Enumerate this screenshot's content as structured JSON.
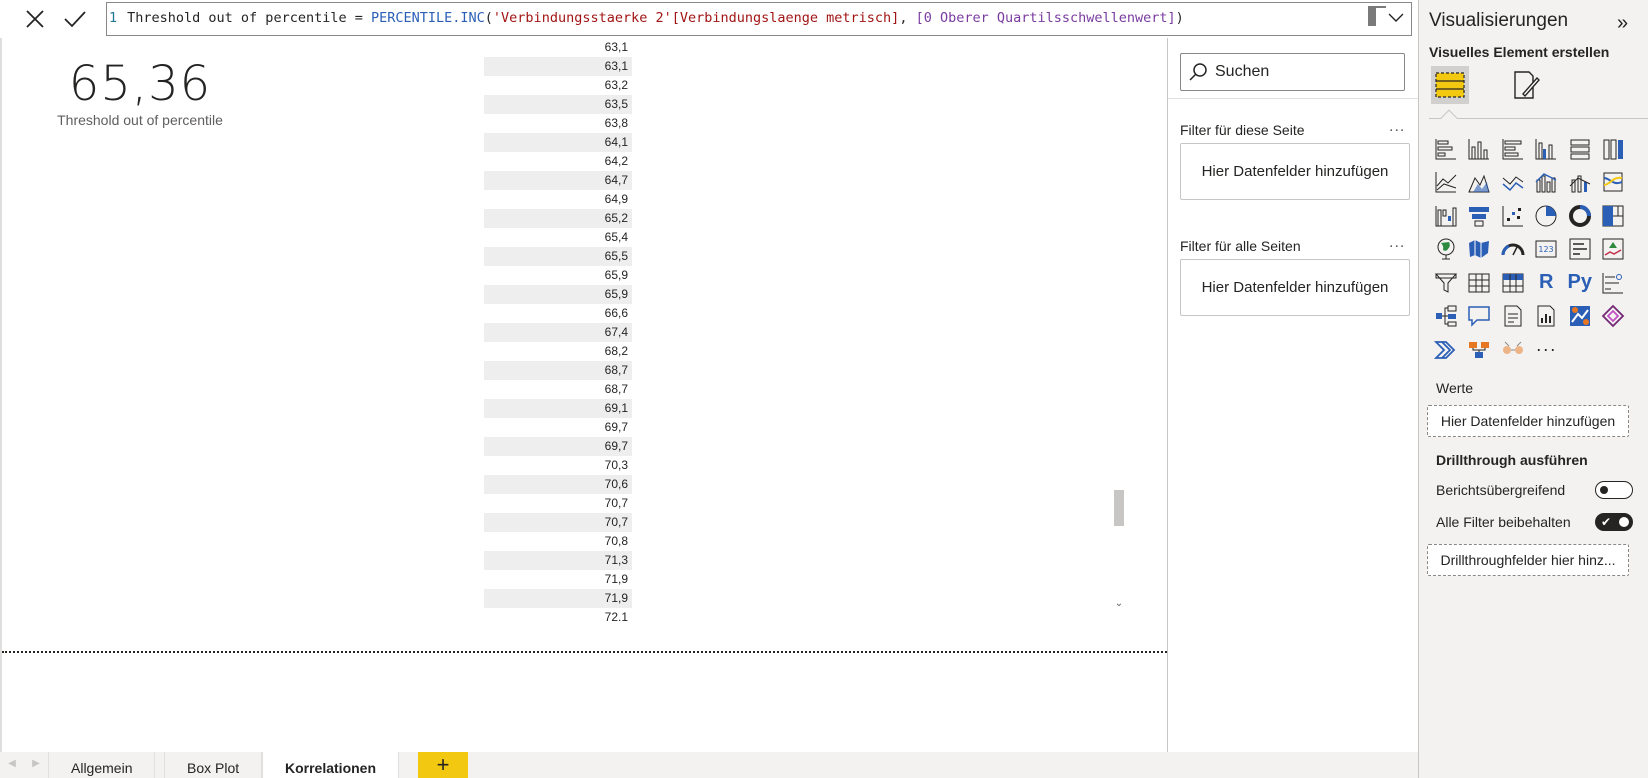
{
  "formula": {
    "line_number": "1",
    "measure_name": "Threshold out of percentile = ",
    "function": "PERCENTILE.INC",
    "open_paren": "(",
    "table_column": "'Verbindungsstaerke 2'[Verbindungslaenge metrisch]",
    "separator": ", ",
    "measure_ref": "[0 Oberer Quartilsschwellenwert]",
    "close_paren": ")"
  },
  "card": {
    "value": "65,36",
    "label": "Threshold out of percentile"
  },
  "value_list": [
    "63,1",
    "63,1",
    "63,2",
    "63,5",
    "63,8",
    "64,1",
    "64,2",
    "64,7",
    "64,9",
    "65,2",
    "65,4",
    "65,5",
    "65,9",
    "65,9",
    "66,6",
    "67,4",
    "68,2",
    "68,7",
    "68,7",
    "69,1",
    "69,7",
    "69,7",
    "70,3",
    "70,6",
    "70,7",
    "70,7",
    "70,8",
    "71,3",
    "71,9",
    "71,9",
    "72.1"
  ],
  "page_tabs": [
    {
      "label": "Allgemein",
      "active": false
    },
    {
      "label": "Box Plot",
      "active": false
    },
    {
      "label": "Korrelationen",
      "active": true
    }
  ],
  "add_page_label": "+",
  "filters": {
    "search_placeholder": "Suchen",
    "page_heading": "Filter für diese Seite",
    "page_well": "Hier Datenfelder hinzufügen",
    "all_heading": "Filter für alle Seiten",
    "all_well": "Hier Datenfelder hinzufügen",
    "more": "..."
  },
  "viz": {
    "title": "Visualisierungen",
    "collapse": "»",
    "subtitle": "Visuelles Element erstellen",
    "values_label": "Werte",
    "values_well": "Hier Datenfelder hinzufügen",
    "drill_heading": "Drillthrough ausführen",
    "cross_report_label": "Berichtsübergreifend",
    "cross_report_on": false,
    "keep_filters_label": "Alle Filter beibehalten",
    "keep_filters_on": true,
    "drill_well": "Drillthroughfelder hier hinz...",
    "r_label": "R",
    "py_label": "Py",
    "more": "···",
    "accent": "#f2c811"
  }
}
